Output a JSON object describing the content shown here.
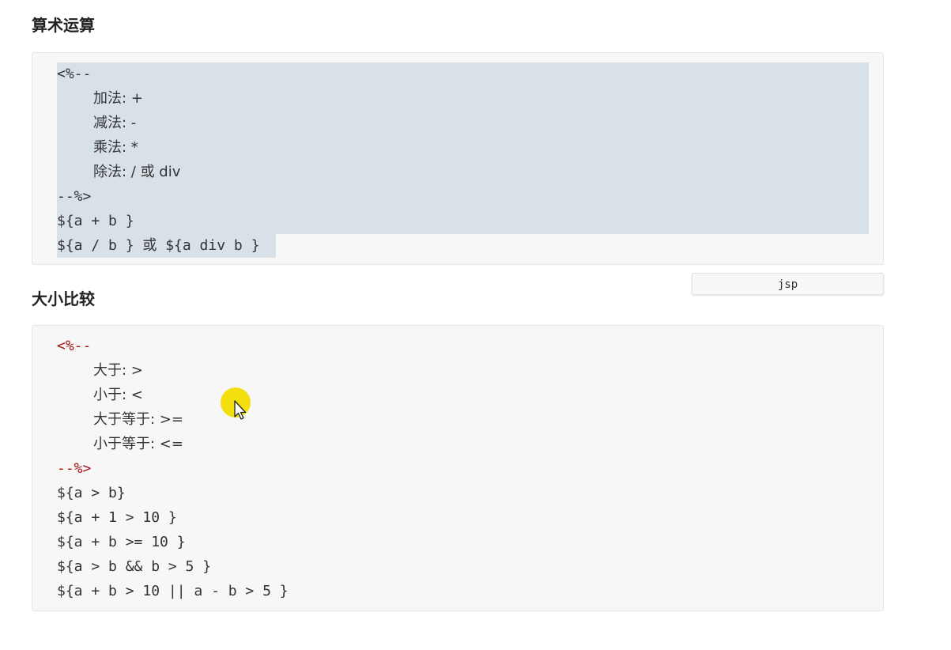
{
  "sections": [
    {
      "title": "算术运算",
      "code_lines": [
        "<%--",
        "加法: +",
        "减法: -",
        "乘法: *",
        "除法: / 或 div",
        "--%>",
        "${a + b }",
        "${a / b } 或 ${a div b }"
      ]
    },
    {
      "title": "大小比较",
      "code_lines": [
        "<%--",
        "大于: >",
        "小于: <",
        "大于等于: >=",
        "小于等于: <=",
        "--%>",
        "${a > b}",
        "${a + 1 > 10 }",
        "${a + b >= 10 }",
        "${a > b && b > 5 }",
        "${a + b > 10 || a - b > 5 }"
      ]
    }
  ],
  "code_language_tab": "jsp",
  "colors": {
    "selection": "#d9e1e8",
    "code_background": "#f7f7f7",
    "operator": "#a31515",
    "keyword": "#d7251d",
    "cursor_highlight": "#f2dd00"
  },
  "icons": [
    "mouse-pointer-icon"
  ]
}
